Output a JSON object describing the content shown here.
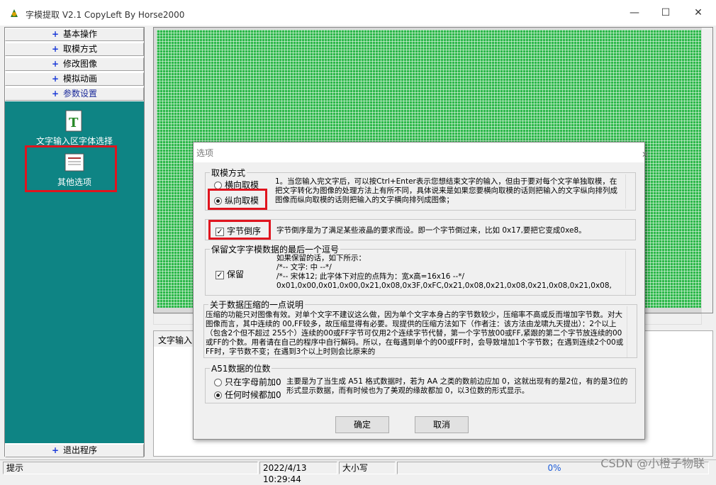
{
  "window": {
    "title": "字模提取 V2.1   CopyLeft By Horse2000"
  },
  "sidebar": {
    "items": [
      {
        "label": "基本操作"
      },
      {
        "label": "取模方式"
      },
      {
        "label": "修改图像"
      },
      {
        "label": "模拟动画"
      },
      {
        "label": "参数设置"
      }
    ],
    "icons": [
      {
        "label": "文字输入区字体选择"
      },
      {
        "label": "其他选项"
      }
    ],
    "exit_label": "退出程序"
  },
  "lower_panel": {
    "tab_label": "文字输入"
  },
  "statusbar": {
    "hint": "提示",
    "datetime": "2022/4/13 10:29:44",
    "size_label": "大小写",
    "percent": "0%"
  },
  "watermark": "CSDN @小橙子物联",
  "dialog": {
    "title": "选项",
    "mode": {
      "group_label": "取模方式",
      "option_horizontal": "横向取模",
      "option_vertical": "纵向取模",
      "selected": "vertical",
      "note": "1。当您输入完文字后，可以按Ctrl+Enter表示您想结束文字的输入，但由于要对每个文字单独取模，在把文字转化为图像的处理方法上有所不同，具体说来是如果您要横向取模的话则把输入的文字纵向排列成图像而纵向取模的话则把输入的文字横向排列成图像；"
    },
    "byte_reverse": {
      "label": "字节倒序",
      "checked": true,
      "note": "字节倒序是为了满足某些液晶的要求而设。即一个字节倒过来，比如 0x17,要把它变成0xe8。"
    },
    "keep_last_comma": {
      "group_label": "保留文字字模数据的最后一个逗号",
      "label": "保留",
      "checked": true,
      "lines": [
        "如果保留的话，如下所示：",
        "/*--  文字:  中  --*/",
        "/*--  宋体12;  此字体下对应的点阵为：宽x高=16x16   --*/",
        "0x01,0x00,0x01,0x00,0x21,0x08,0x3F,0xFC,0x21,0x08,0x21,0x08,0x21,0x08,0x21,0x08,"
      ]
    },
    "compression": {
      "group_label": "关于数据压缩的一点说明",
      "text": "压缩的功能只对图像有效。对单个文字不建议这么做，因为单个文字本身占的字节数较少，压缩率不高或反而增加字节数。对大图像而言，其中连续的 00,FF较多，故压缩显得有必要。现提供的压缩方法如下（作者注：该方法由龙啸九天提出）：2个以上（包含2个但不超过 255个）连续的00或FF字节可仅用2个连续字节代替，第一个字节放00或FF,紧跟的第二个字节放连续的00或FF的个数。用者请在自己的程序中自行解码。所以，在每遇到单个的00或FF时，会导致增加1个字节数；在遇到连续2个00或FF时，字节数不变；在遇到3个以上时则会比原来的"
    },
    "a51": {
      "group_label": "A51数据的位数",
      "option_letter_only": "只在字母前加0",
      "option_always": "任何时候都加0",
      "selected": "always",
      "note": "主要是为了当生成 A51 格式数据时，若为 AA 之类的数前边应加 0，这就出现有的是2位，有的是3位的形式显示数据，而有时候也为了美观的缘故都加 0，以3位数的形式显示。"
    },
    "ok_label": "确定",
    "cancel_label": "取消"
  },
  "colors": {
    "teal": "#0e8484",
    "grid_green": "#2db84a",
    "highlight_red": "#e0141e"
  }
}
